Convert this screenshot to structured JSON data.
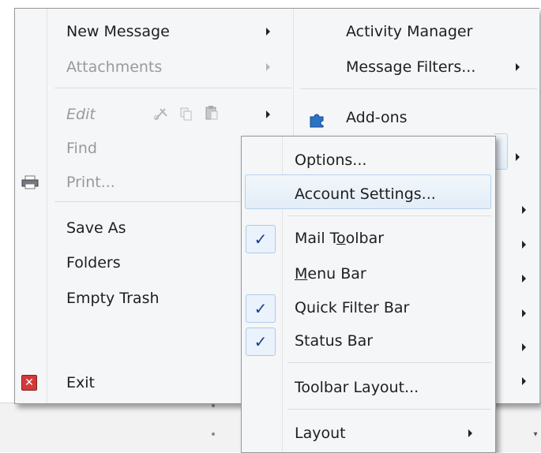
{
  "main_menu": {
    "left": {
      "new_message": "New Message",
      "attachments": "Attachments",
      "edit": "Edit",
      "find": "Find",
      "print": "Print...",
      "save_as": "Save As",
      "folders": "Folders",
      "empty_trash": "Empty Trash",
      "exit": "Exit"
    },
    "right": {
      "activity_manager": "Activity Manager",
      "message_filters": "Message Filters...",
      "addons": "Add-ons"
    }
  },
  "options_submenu": {
    "options": "Options...",
    "account_settings": "Account Settings...",
    "mail_toolbar_pre": "Mail T",
    "mail_toolbar_acc": "o",
    "mail_toolbar_post": "olbar",
    "menu_bar_acc": "M",
    "menu_bar_post": "enu Bar",
    "quick_filter_bar": "Quick Filter Bar",
    "status_bar": "Status Bar",
    "toolbar_layout": "Toolbar Layout...",
    "layout": "Layout"
  },
  "checks": {
    "mail_toolbar": true,
    "menu_bar": false,
    "quick_filter_bar": true,
    "status_bar": true
  },
  "icons": [
    "printer-icon",
    "exit-icon",
    "addons-puzzle-icon",
    "cut-icon",
    "copy-icon",
    "paste-icon",
    "check-icon"
  ]
}
